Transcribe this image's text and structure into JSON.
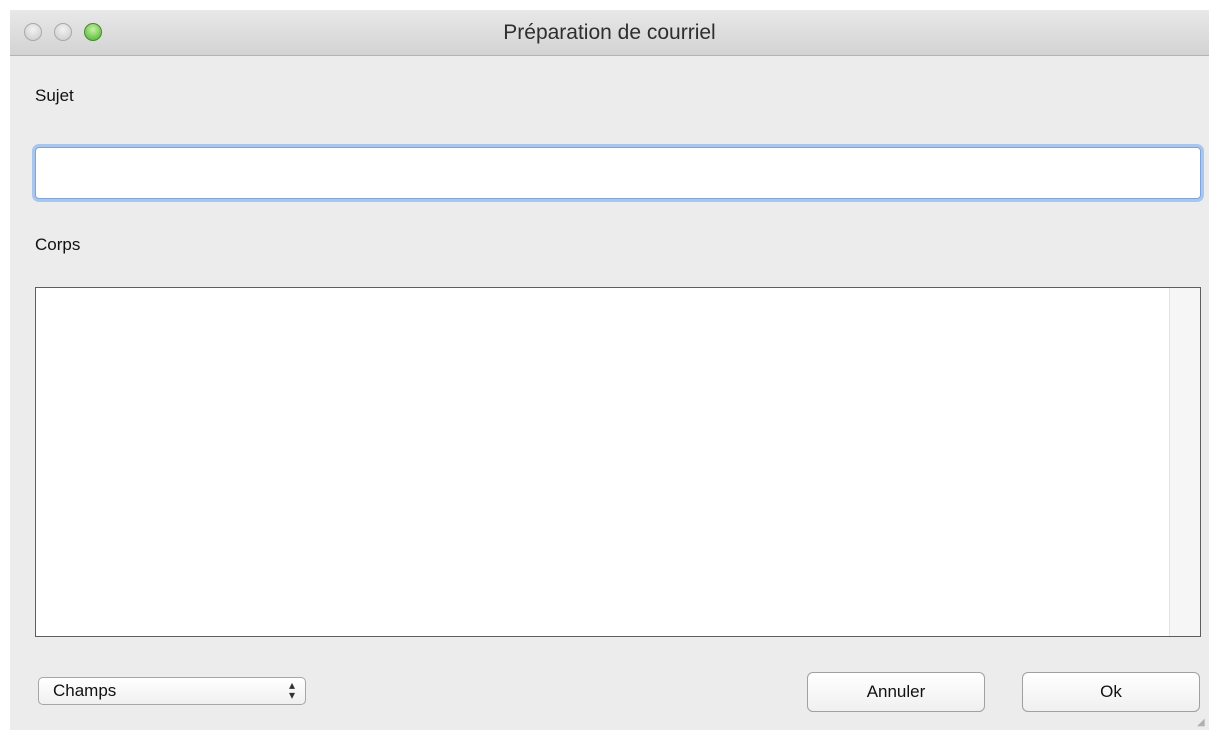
{
  "window": {
    "title": "Préparation de courriel"
  },
  "form": {
    "subject_label": "Sujet",
    "subject_value": "",
    "body_label": "Corps",
    "body_value": ""
  },
  "footer": {
    "fields_select": {
      "selected": "Champs",
      "arrows_icon": "updown-chevron-icon"
    },
    "cancel_label": "Annuler",
    "ok_label": "Ok"
  },
  "icons": {
    "close": "close-icon",
    "minimize": "minimize-icon",
    "zoom": "zoom-icon"
  },
  "colors": {
    "window_bg": "#ececec",
    "focus_ring": "#a9c6ef",
    "zoom_button": "#48ad2c"
  }
}
